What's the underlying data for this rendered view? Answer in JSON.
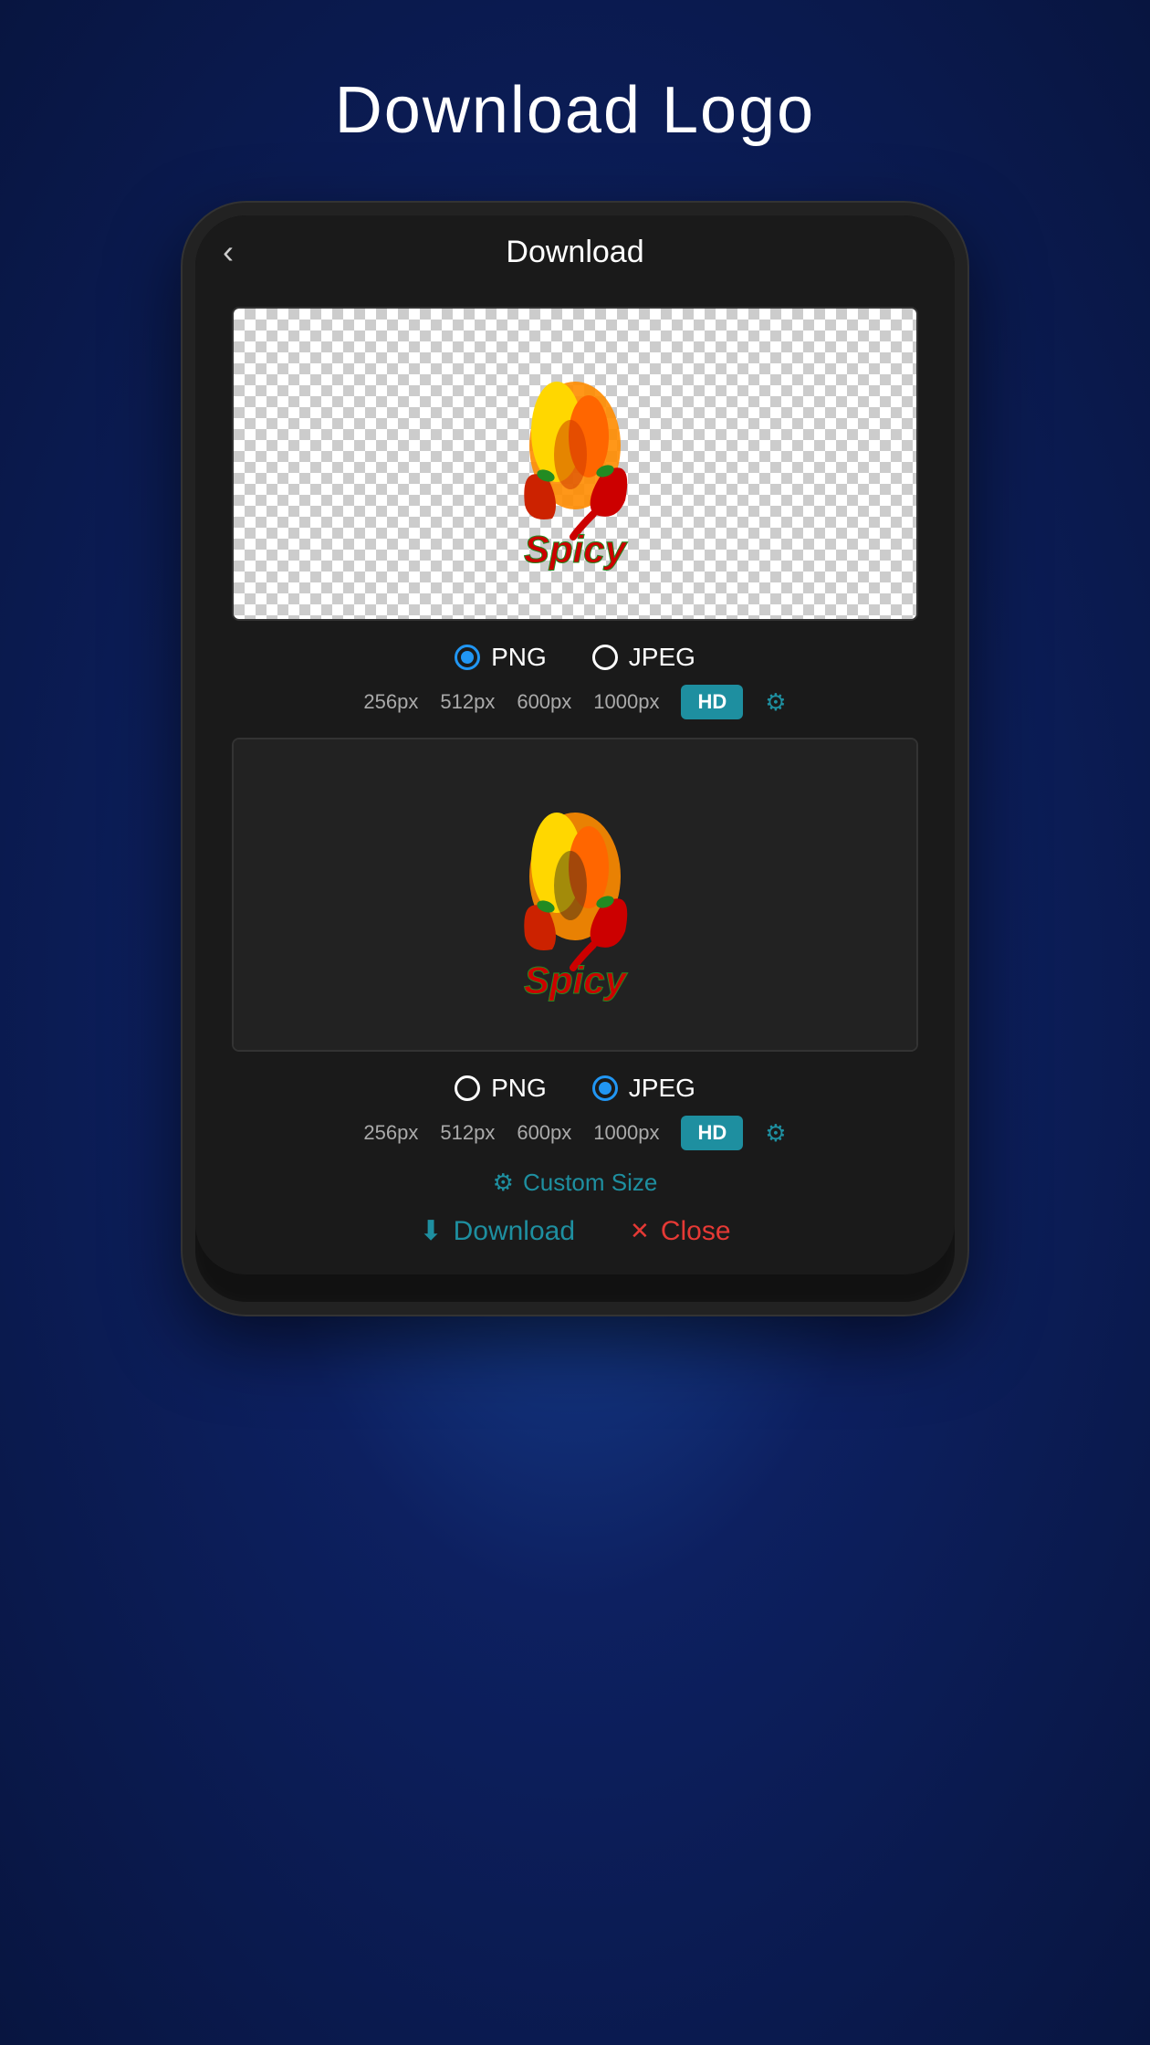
{
  "page": {
    "title": "Download Logo"
  },
  "phone": {
    "header": {
      "back_label": "‹",
      "screen_title": "Download"
    },
    "preview1": {
      "background": "transparent",
      "format_options": [
        "PNG",
        "JPEG"
      ],
      "selected_format": "PNG",
      "size_options": [
        "256px",
        "512px",
        "600px",
        "1000px",
        "HD"
      ],
      "gear_label": "⚙"
    },
    "preview2": {
      "background": "dark",
      "format_options": [
        "PNG",
        "JPEG"
      ],
      "selected_format": "JPEG",
      "size_options": [
        "256px",
        "512px",
        "600px",
        "1000px",
        "HD"
      ],
      "gear_label": "⚙"
    },
    "custom_size": {
      "icon": "⚙",
      "label": "Custom Size"
    },
    "actions": {
      "download_icon": "⬇",
      "download_label": "Download",
      "close_icon": "✕",
      "close_label": "Close"
    }
  }
}
